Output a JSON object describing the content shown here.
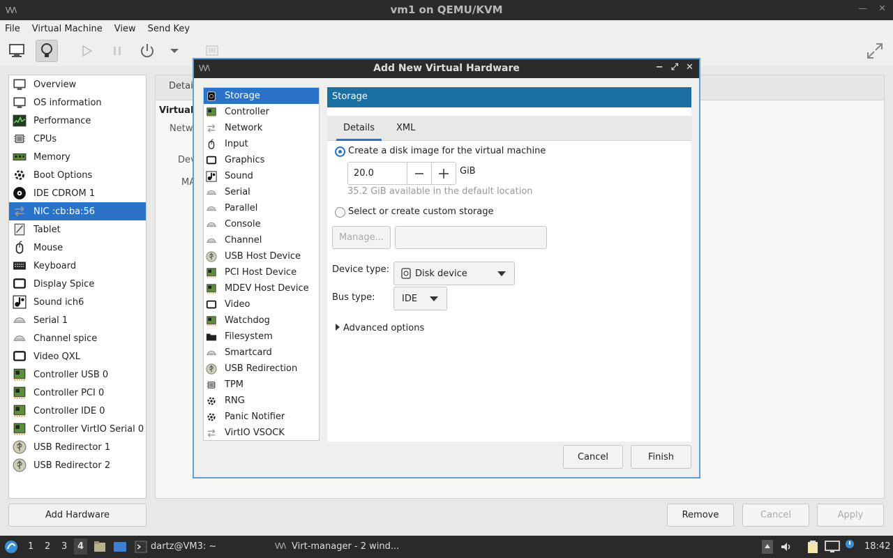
{
  "window": {
    "title": "vm1 on QEMU/KVM",
    "logo": "\\/\\/\\",
    "controls": [
      "—",
      "✕"
    ]
  },
  "menu": [
    "File",
    "Virtual Machine",
    "View",
    "Send Key"
  ],
  "hardware": [
    {
      "label": "Overview",
      "icon": "monitor-icon"
    },
    {
      "label": "OS information",
      "icon": "monitor-icon"
    },
    {
      "label": "Performance",
      "icon": "chart-icon"
    },
    {
      "label": "CPUs",
      "icon": "chip-icon"
    },
    {
      "label": "Memory",
      "icon": "memory-icon"
    },
    {
      "label": "Boot Options",
      "icon": "gear-icon"
    },
    {
      "label": "IDE CDROM 1",
      "icon": "disc-icon"
    },
    {
      "label": "NIC :cb:ba:56",
      "icon": "network-icon",
      "selected": true
    },
    {
      "label": "Tablet",
      "icon": "tablet-icon"
    },
    {
      "label": "Mouse",
      "icon": "mouse-icon"
    },
    {
      "label": "Keyboard",
      "icon": "keyboard-icon"
    },
    {
      "label": "Display Spice",
      "icon": "display-icon"
    },
    {
      "label": "Sound ich6",
      "icon": "sound-icon"
    },
    {
      "label": "Serial 1",
      "icon": "serial-icon"
    },
    {
      "label": "Channel spice",
      "icon": "serial-icon"
    },
    {
      "label": "Video QXL",
      "icon": "display-icon"
    },
    {
      "label": "Controller USB 0",
      "icon": "card-icon"
    },
    {
      "label": "Controller PCI 0",
      "icon": "card-icon"
    },
    {
      "label": "Controller IDE 0",
      "icon": "card-icon"
    },
    {
      "label": "Controller VirtIO Serial 0",
      "icon": "card-icon"
    },
    {
      "label": "USB Redirector 1",
      "icon": "usb-icon"
    },
    {
      "label": "USB Redirector 2",
      "icon": "usb-icon"
    }
  ],
  "add_hardware": "Add Hardware",
  "behind": {
    "tab": "Detai",
    "section": "Virtual",
    "netw": "Netw",
    "dev": "Dev",
    "mac": "MA"
  },
  "bottom": {
    "remove": "Remove",
    "cancel": "Cancel",
    "apply": "Apply"
  },
  "dialog": {
    "title": "Add New Virtual Hardware",
    "logo": "\\/\\/\\",
    "controls": [
      "−",
      "⤢",
      "✕"
    ],
    "types": [
      {
        "label": "Storage",
        "icon": "disk-icon",
        "selected": true
      },
      {
        "label": "Controller",
        "icon": "card-icon"
      },
      {
        "label": "Network",
        "icon": "network-icon"
      },
      {
        "label": "Input",
        "icon": "mouse-icon"
      },
      {
        "label": "Graphics",
        "icon": "display-icon"
      },
      {
        "label": "Sound",
        "icon": "sound-icon"
      },
      {
        "label": "Serial",
        "icon": "serial-icon"
      },
      {
        "label": "Parallel",
        "icon": "serial-icon"
      },
      {
        "label": "Console",
        "icon": "serial-icon"
      },
      {
        "label": "Channel",
        "icon": "serial-icon"
      },
      {
        "label": "USB Host Device",
        "icon": "usb-icon"
      },
      {
        "label": "PCI Host Device",
        "icon": "card-icon"
      },
      {
        "label": "MDEV Host Device",
        "icon": "card-icon"
      },
      {
        "label": "Video",
        "icon": "display-icon"
      },
      {
        "label": "Watchdog",
        "icon": "card-icon"
      },
      {
        "label": "Filesystem",
        "icon": "folder-icon"
      },
      {
        "label": "Smartcard",
        "icon": "serial-icon"
      },
      {
        "label": "USB Redirection",
        "icon": "usb-icon"
      },
      {
        "label": "TPM",
        "icon": "chip-icon"
      },
      {
        "label": "RNG",
        "icon": "gear-icon"
      },
      {
        "label": "Panic Notifier",
        "icon": "gear-icon"
      },
      {
        "label": "VirtIO VSOCK",
        "icon": "network-icon"
      }
    ],
    "header": "Storage",
    "tabs": [
      "Details",
      "XML"
    ],
    "opt_create": "Create a disk image for the virtual machine",
    "size_value": "20.0",
    "size_unit": "GiB",
    "available": "35.2 GiB available in the default location",
    "opt_custom": "Select or create custom storage",
    "manage": "Manage...",
    "device_type_label": "Device type:",
    "device_type_value": "Disk device",
    "bus_type_label": "Bus type:",
    "bus_type_value": "IDE",
    "advanced": "Advanced options",
    "cancel": "Cancel",
    "finish": "Finish"
  },
  "taskbar": {
    "workspaces": [
      "1",
      "2",
      "3",
      "4"
    ],
    "terminal": "dartz@VM3: ~",
    "virt": "Virt-manager - 2 wind...",
    "clock": "18:42"
  },
  "colors": {
    "accent": "#2b73c8",
    "storage_header": "#1a6fa3",
    "titlebar": "#2b2b2b"
  }
}
